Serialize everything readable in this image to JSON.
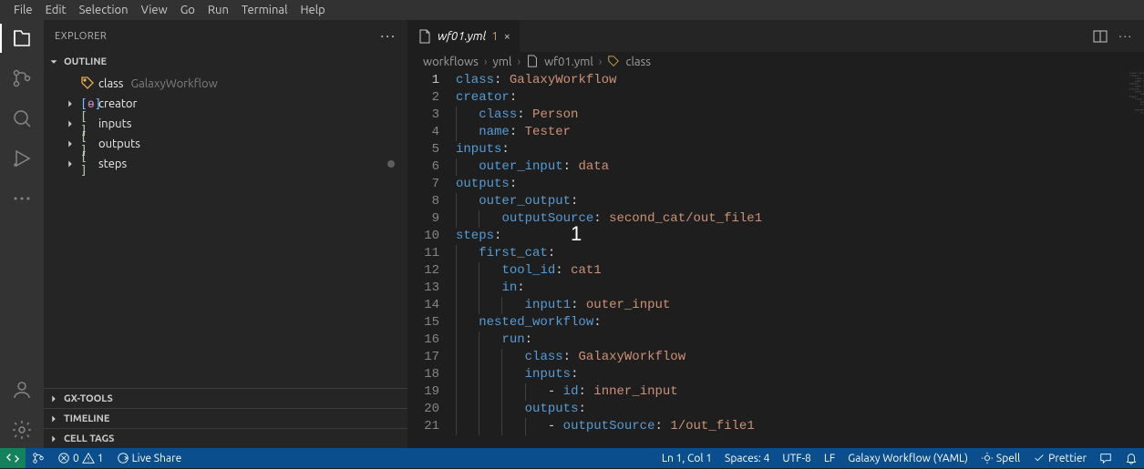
{
  "menubar": [
    "File",
    "Edit",
    "Selection",
    "View",
    "Go",
    "Run",
    "Terminal",
    "Help"
  ],
  "sidebar": {
    "title": "EXPLORER",
    "outline": {
      "label": "OUTLINE",
      "items": [
        {
          "icon": "tag",
          "name": "class",
          "desc": "GalaxyWorkflow",
          "leaf": true
        },
        {
          "icon": "brackets",
          "name": "creator",
          "leaf": false
        },
        {
          "icon": "array",
          "name": "inputs",
          "leaf": false
        },
        {
          "icon": "array",
          "name": "outputs",
          "leaf": false
        },
        {
          "icon": "array",
          "name": "steps",
          "leaf": false
        }
      ]
    },
    "collapsed": [
      "GX-TOOLS",
      "TIMELINE",
      "CELL TAGS"
    ]
  },
  "tab": {
    "name": "wf01.yml",
    "count": "1"
  },
  "breadcrumbs": [
    "workflows",
    "yml",
    "wf01.yml",
    "class"
  ],
  "code_lines": [
    {
      "n": 1,
      "i": 0,
      "t": [
        [
          "k",
          "class"
        ],
        [
          "",
          ":"
        ],
        [
          "",
          " "
        ],
        [
          "s",
          "GalaxyWorkflow"
        ]
      ]
    },
    {
      "n": 2,
      "i": 0,
      "t": [
        [
          "k",
          "creator"
        ],
        [
          "",
          ":"
        ]
      ]
    },
    {
      "n": 3,
      "i": 1,
      "t": [
        [
          "k",
          "class"
        ],
        [
          "",
          ":"
        ],
        [
          "",
          " "
        ],
        [
          "s",
          "Person"
        ]
      ]
    },
    {
      "n": 4,
      "i": 1,
      "t": [
        [
          "k",
          "name"
        ],
        [
          "",
          ":"
        ],
        [
          "",
          " "
        ],
        [
          "s",
          "Tester"
        ]
      ]
    },
    {
      "n": 5,
      "i": 0,
      "t": [
        [
          "k",
          "inputs"
        ],
        [
          "",
          ":"
        ]
      ]
    },
    {
      "n": 6,
      "i": 1,
      "t": [
        [
          "k",
          "outer_input"
        ],
        [
          "",
          ":"
        ],
        [
          "",
          " "
        ],
        [
          "s",
          "data"
        ]
      ]
    },
    {
      "n": 7,
      "i": 0,
      "t": [
        [
          "k",
          "outputs"
        ],
        [
          "",
          ":"
        ]
      ]
    },
    {
      "n": 8,
      "i": 1,
      "t": [
        [
          "k",
          "outer_output"
        ],
        [
          "",
          ":"
        ]
      ]
    },
    {
      "n": 9,
      "i": 2,
      "t": [
        [
          "k",
          "outputSource"
        ],
        [
          "",
          ":"
        ],
        [
          "",
          " "
        ],
        [
          "s",
          "second_cat/out_file1"
        ]
      ]
    },
    {
      "n": 10,
      "i": 0,
      "t": [
        [
          "k",
          "steps"
        ],
        [
          "",
          ":"
        ]
      ]
    },
    {
      "n": 11,
      "i": 1,
      "t": [
        [
          "k",
          "first_cat"
        ],
        [
          "",
          ":"
        ]
      ]
    },
    {
      "n": 12,
      "i": 2,
      "t": [
        [
          "k",
          "tool_id"
        ],
        [
          "",
          ":"
        ],
        [
          "",
          " "
        ],
        [
          "s",
          "cat1"
        ]
      ]
    },
    {
      "n": 13,
      "i": 2,
      "t": [
        [
          "k",
          "in"
        ],
        [
          "",
          ":"
        ]
      ]
    },
    {
      "n": 14,
      "i": 3,
      "t": [
        [
          "k",
          "input1"
        ],
        [
          "",
          ":"
        ],
        [
          "",
          " "
        ],
        [
          "s",
          "outer_input"
        ]
      ]
    },
    {
      "n": 15,
      "i": 1,
      "t": [
        [
          "k",
          "nested_workflow"
        ],
        [
          "",
          ":"
        ]
      ]
    },
    {
      "n": 16,
      "i": 2,
      "t": [
        [
          "k",
          "run"
        ],
        [
          "",
          ":"
        ]
      ]
    },
    {
      "n": 17,
      "i": 3,
      "t": [
        [
          "k",
          "class"
        ],
        [
          "",
          ":"
        ],
        [
          "",
          " "
        ],
        [
          "s",
          "GalaxyWorkflow"
        ]
      ]
    },
    {
      "n": 18,
      "i": 3,
      "t": [
        [
          "k",
          "inputs"
        ],
        [
          "",
          ":"
        ]
      ]
    },
    {
      "n": 19,
      "i": 4,
      "t": [
        [
          "",
          "- "
        ],
        [
          "k",
          "id"
        ],
        [
          "",
          ":"
        ],
        [
          "",
          " "
        ],
        [
          "s",
          "inner_input"
        ]
      ]
    },
    {
      "n": 20,
      "i": 3,
      "t": [
        [
          "k",
          "outputs"
        ],
        [
          "",
          ":"
        ]
      ]
    },
    {
      "n": 21,
      "i": 4,
      "t": [
        [
          "",
          "- "
        ],
        [
          "k",
          "outputSource"
        ],
        [
          "",
          ":"
        ],
        [
          "",
          " "
        ],
        [
          "s",
          "1/out_file1"
        ]
      ]
    }
  ],
  "status": {
    "errors": "0",
    "warnings": "1",
    "liveshare": "Live Share",
    "lncol": "Ln 1, Col 1",
    "spaces": "Spaces: 4",
    "enc": "UTF-8",
    "eol": "LF",
    "lang": "Galaxy Workflow (YAML)",
    "spell": "Spell",
    "prettier": "Prettier"
  },
  "cursor": "1"
}
